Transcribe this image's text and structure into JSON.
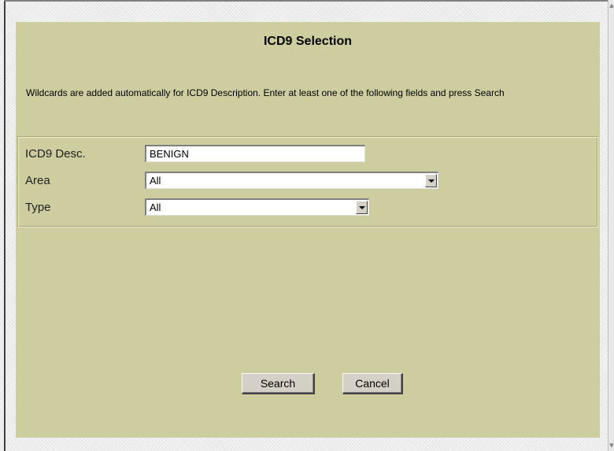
{
  "dialog": {
    "title": "ICD9 Selection",
    "instructions": "Wildcards are added automatically for ICD9 Description. Enter at least one of the following fields and press Search"
  },
  "fields": {
    "icd9_desc": {
      "label": "ICD9 Desc.",
      "value": "BENIGN"
    },
    "area": {
      "label": "Area",
      "selected": "All"
    },
    "type": {
      "label": "Type",
      "selected": "All"
    }
  },
  "buttons": {
    "search": "Search",
    "cancel": "Cancel"
  },
  "colors": {
    "panel": "#cdcd9f",
    "button_face": "#d4d0c8"
  },
  "icons": {
    "scroll_up": "▲",
    "scroll_down": "▼"
  }
}
